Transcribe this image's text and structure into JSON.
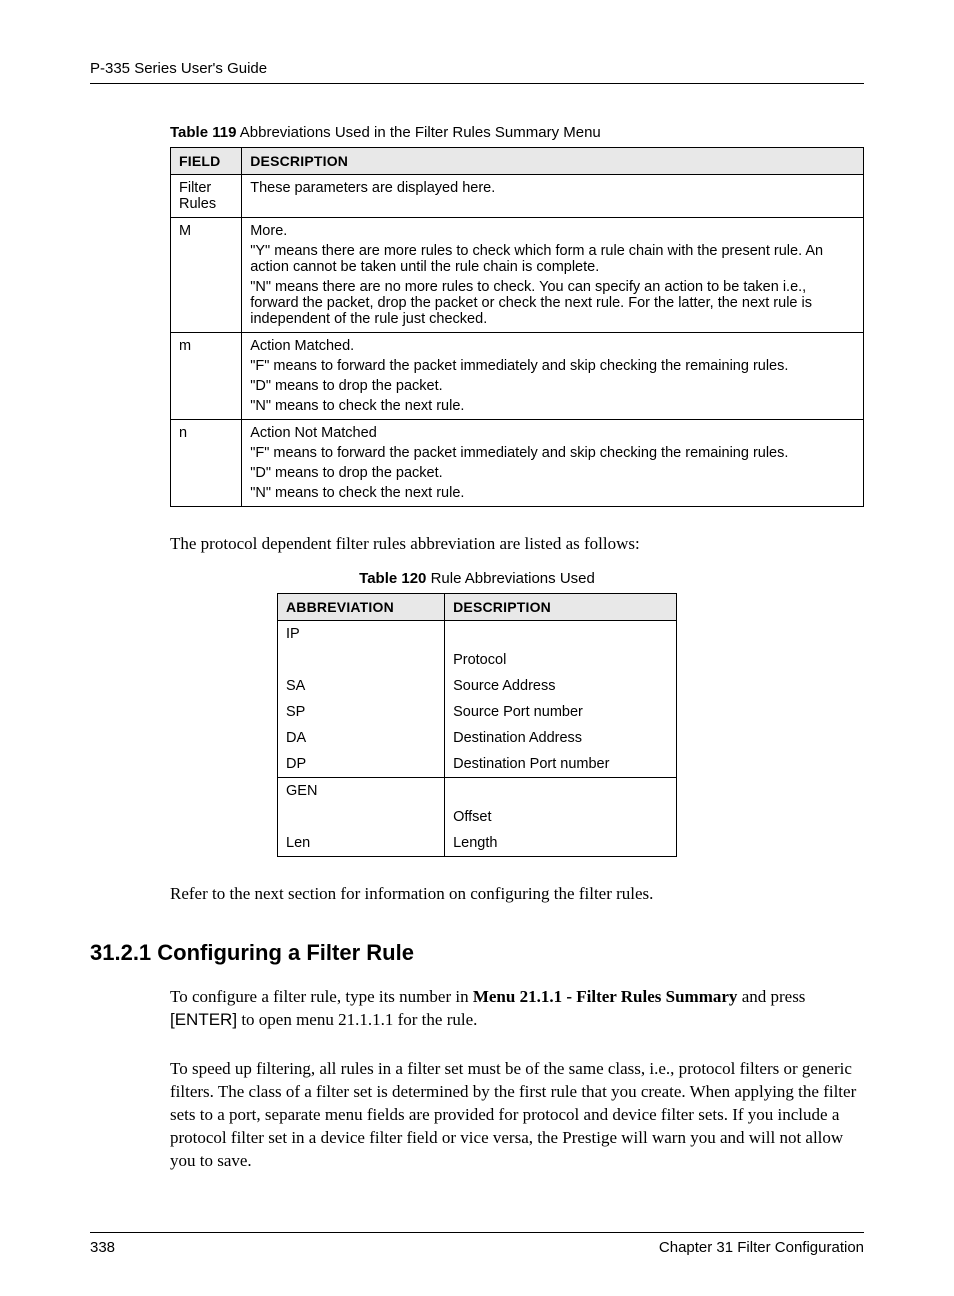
{
  "header": {
    "guide": "P-335 Series User's Guide"
  },
  "table119": {
    "caption_b": "Table 119",
    "caption_rest": "   Abbreviations Used in the Filter Rules Summary Menu",
    "headers": {
      "field": "FIELD",
      "desc": "DESCRIPTION"
    },
    "rows": [
      {
        "field": "Filter Rules",
        "desc": [
          "These parameters are displayed here."
        ]
      },
      {
        "field": "M",
        "desc": [
          "More.",
          "\"Y\" means there are more rules to check which form a rule chain with the present rule. An action cannot be taken until the rule chain is complete.",
          "\"N\" means there are no more rules to check. You can specify an action to be taken i.e., forward the packet, drop the packet or check the next rule. For the latter, the next rule is independent of the rule just checked."
        ]
      },
      {
        "field": "m",
        "desc": [
          "Action Matched.",
          "\"F\" means to forward the packet immediately and skip checking the remaining rules.",
          "\"D\" means to drop the packet.",
          "\"N\" means to check the next rule."
        ]
      },
      {
        "field": "n",
        "desc": [
          "Action Not Matched",
          "\"F\" means to forward the packet immediately and skip checking the remaining rules.",
          "\"D\" means to drop the packet.",
          "\"N\" means to check the next rule."
        ]
      }
    ]
  },
  "para1": "The protocol dependent filter rules abbreviation are listed as follows:",
  "table120": {
    "caption_b": "Table 120",
    "caption_rest": "   Rule Abbreviations Used",
    "headers": {
      "abbr": "ABBREVIATION",
      "desc": "DESCRIPTION"
    },
    "rows": [
      {
        "abbr": "IP",
        "desc": "",
        "section_top": true
      },
      {
        "abbr": "",
        "desc": "Protocol"
      },
      {
        "abbr": "SA",
        "desc": "Source Address"
      },
      {
        "abbr": "SP",
        "desc": "Source Port number"
      },
      {
        "abbr": "DA",
        "desc": "Destination Address"
      },
      {
        "abbr": "DP",
        "desc": "Destination Port number",
        "section_end": true
      },
      {
        "abbr": "GEN",
        "desc": "",
        "section_top": true
      },
      {
        "abbr": "",
        "desc": "Offset"
      },
      {
        "abbr": "Len",
        "desc": "Length",
        "section_end": true
      }
    ]
  },
  "para2": "Refer to the next section for information on configuring the filter rules.",
  "section": {
    "heading": "31.2.1  Configuring a Filter Rule",
    "p1_a": "To configure a filter rule, type its number in ",
    "p1_b": "Menu 21.1.1 - Filter Rules Summary",
    "p1_c": " and press ",
    "p1_d": "[ENTER]",
    "p1_e": " to open menu 21.1.1.1 for the rule.",
    "p2": "To speed up filtering, all rules in a filter set must be of the same class, i.e., protocol filters or generic filters. The class of a filter set is determined by the first rule that you create. When applying the filter sets to a port, separate menu fields are provided for protocol and device filter sets. If you include a protocol filter set in a device filter field or vice versa, the Prestige will warn you and will not allow you to save."
  },
  "footer": {
    "page": "338",
    "chapter": "Chapter 31 Filter Configuration"
  }
}
